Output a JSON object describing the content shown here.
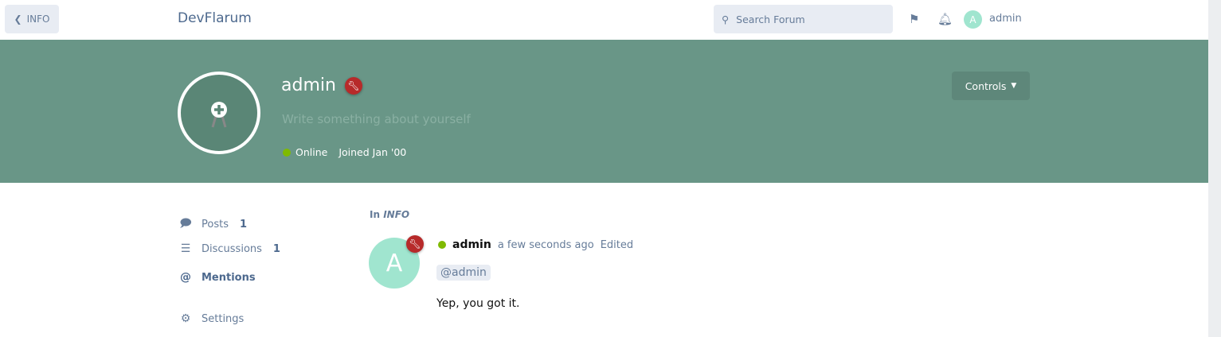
{
  "header": {
    "back_label": "INFO",
    "brand": "DevFlarum",
    "search_placeholder": "Search Forum",
    "user_initial": "A",
    "user_name": "admin"
  },
  "hero": {
    "name": "admin",
    "bio_placeholder": "Write something about yourself",
    "status": "Online",
    "joined": "Joined Jan '00",
    "controls_label": "Controls",
    "background": "#699687"
  },
  "nav": {
    "items": [
      {
        "label": "Posts",
        "count": "1"
      },
      {
        "label": "Discussions",
        "count": "1"
      },
      {
        "label": "Mentions"
      },
      {
        "label": "Settings"
      }
    ]
  },
  "post": {
    "in_label": "In",
    "discussion": "INFO",
    "avatar_initial": "A",
    "author": "admin",
    "time": "a few seconds ago",
    "edited": "Edited",
    "mention": "@admin",
    "body": "Yep, you got it."
  }
}
